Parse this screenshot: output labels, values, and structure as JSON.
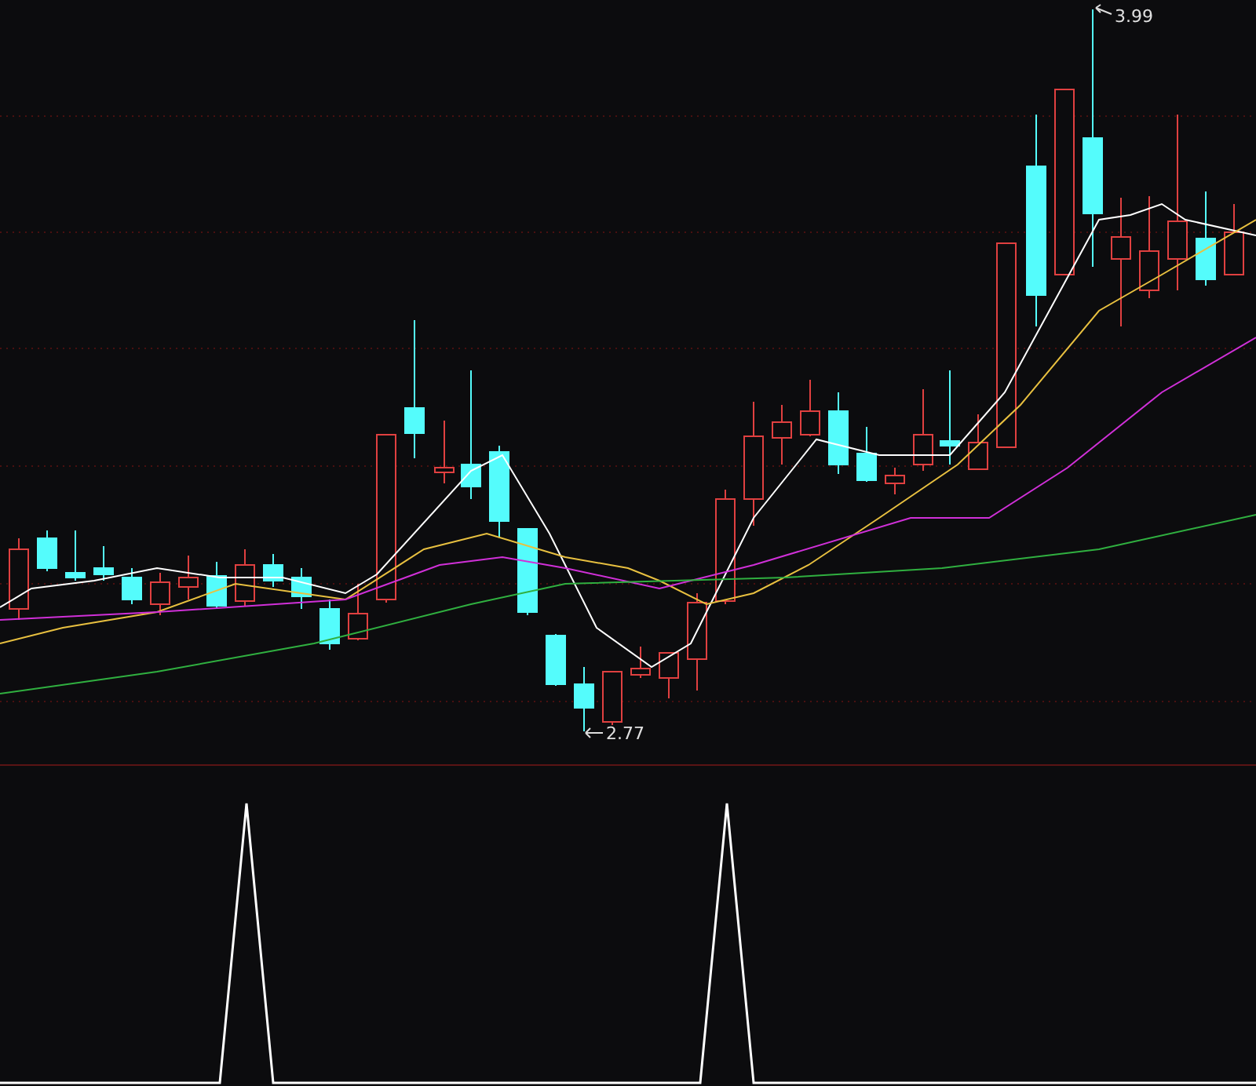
{
  "chart": {
    "high_label": "3.99",
    "low_label": "2.77"
  }
}
